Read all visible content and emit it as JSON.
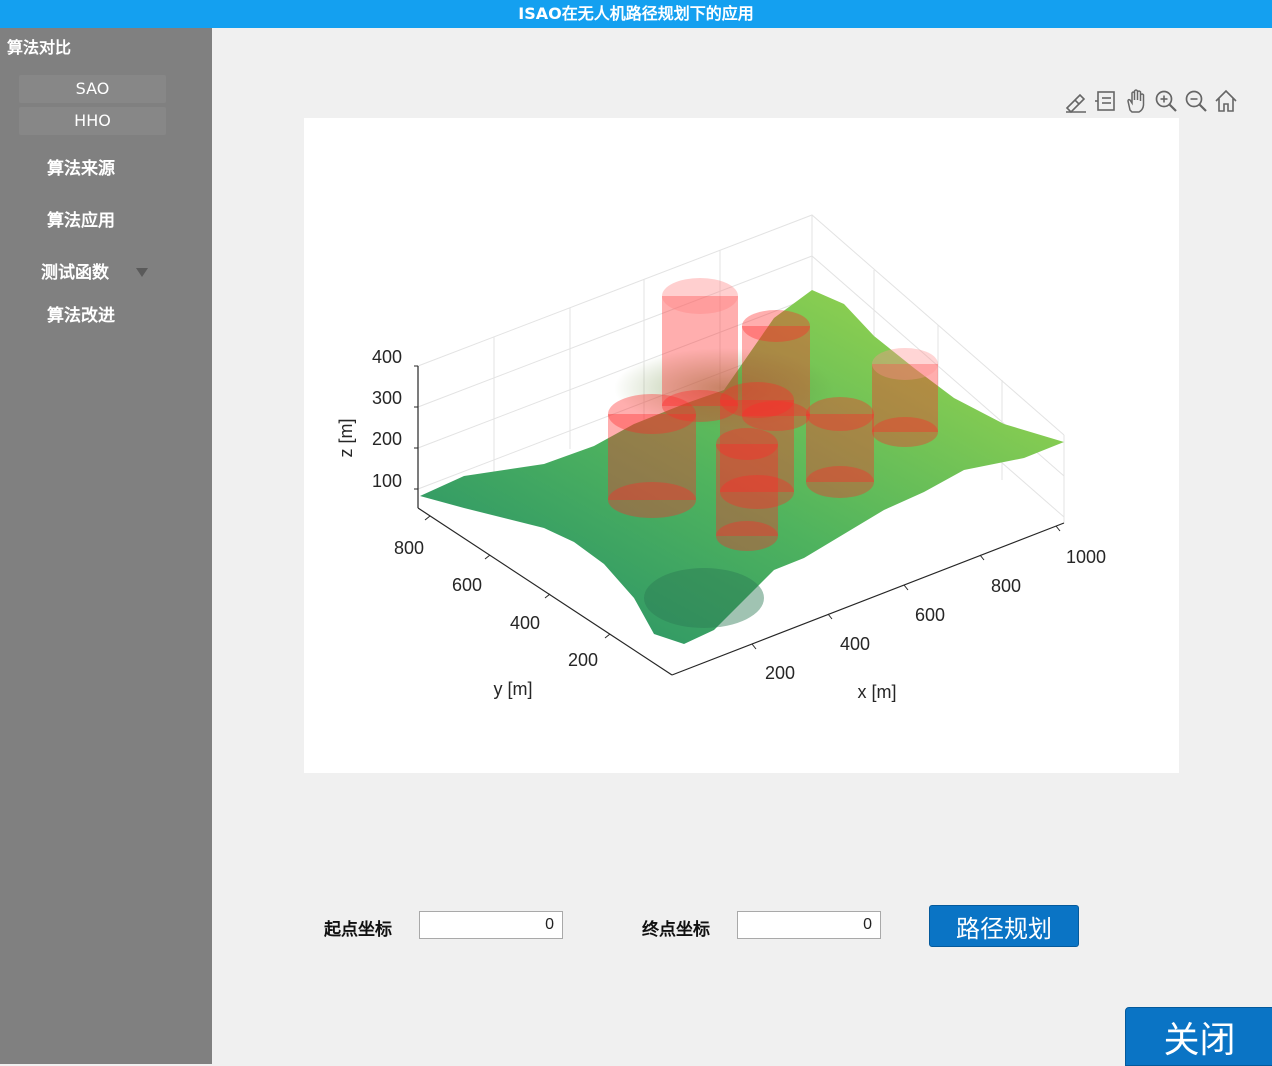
{
  "window": {
    "title": "ISAO在无人机路径规划下的应用"
  },
  "sidebar": {
    "group_title": "算法对比",
    "sub_items": [
      "SAO",
      "HHO"
    ],
    "items": [
      "算法来源",
      "算法应用",
      "测试函数",
      "算法改进"
    ]
  },
  "axes_toolbar": {
    "icons": [
      "brush-icon",
      "datatip-icon",
      "pan-icon",
      "zoom-in-icon",
      "zoom-out-icon",
      "home-icon"
    ]
  },
  "plot": {
    "xlabel": "x [m]",
    "ylabel": "y [m]",
    "zlabel": "z [m]",
    "x_ticks": [
      "200",
      "400",
      "600",
      "800",
      "1000"
    ],
    "y_ticks": [
      "200",
      "400",
      "600",
      "800"
    ],
    "z_ticks": [
      "100",
      "200",
      "300",
      "400"
    ],
    "colors": {
      "terrain_low": "#2e9a6e",
      "terrain_high": "#9ad64a",
      "obstacle": "#ff2020"
    }
  },
  "form": {
    "start_label": "起点坐标",
    "start_value": "0",
    "end_label": "终点坐标",
    "end_value": "0",
    "plan_button": "路径规划",
    "close_button": "关闭"
  }
}
